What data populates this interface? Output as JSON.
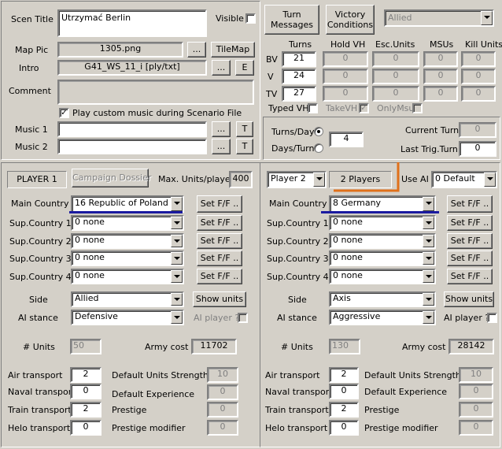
{
  "scenario": {
    "title_label": "Scen Title",
    "title_value": "Utrzymać Berlin",
    "visible_label": "Visible",
    "map_pic_label": "Map Pic",
    "map_pic_value": "1305.png",
    "browse_label": "...",
    "tilemap_label": "TileMap",
    "intro_label": "Intro",
    "intro_value": "G41_WS_11_i  [ply/txt]",
    "e_label": "E",
    "comment_label": "Comment",
    "play_music_label": "Play custom music during Scenario File",
    "music1_label": "Music 1",
    "music2_label": "Music 2",
    "t_label": "T"
  },
  "top_right": {
    "turn_messages_label": "Turn\nMessages",
    "victory_conditions_label": "Victory\nConditions",
    "allied_value": "Allied",
    "col_turns": "Turns",
    "col_hold_vh": "Hold VH",
    "col_esc_units": "Esc.Units",
    "col_msus": "MSUs",
    "col_kill_units": "Kill Units",
    "rows": [
      {
        "label": "BV",
        "turns": "21",
        "hold": "0",
        "esc": "0",
        "msu": "0",
        "kill": "0"
      },
      {
        "label": "V",
        "turns": "24",
        "hold": "0",
        "esc": "0",
        "msu": "0",
        "kill": "0"
      },
      {
        "label": "TV",
        "turns": "27",
        "hold": "0",
        "esc": "0",
        "msu": "0",
        "kill": "0"
      }
    ],
    "typed_vh": "Typed VH",
    "take_vh": "TakeVH",
    "only_msu": "OnlyMsu",
    "turns_per_day": "Turns/Day",
    "days_per_turn": "Days/Turn",
    "turns_value": "4",
    "current_turn_label": "Current Turn",
    "current_turn_value": "0",
    "last_trig_label": "Last Trig.Turn",
    "last_trig_value": "0"
  },
  "player1": {
    "player_label": "PLAYER 1",
    "campaign_dossier": "Campaign Dossier",
    "max_units_label": "Max. Units/player",
    "max_units_value": "400",
    "main_country_label": "Main Country",
    "main_country_value": "16 Republic of Poland",
    "set_ff": "Set F/F ..",
    "sup_labels": [
      "Sup.Country 1",
      "Sup.Country 2",
      "Sup.Country 3",
      "Sup.Country 4"
    ],
    "sup_values": [
      "0 none",
      "0 none",
      "0 none",
      "0 none"
    ],
    "side_label": "Side",
    "side_value": "Allied",
    "show_units": "Show units",
    "ai_stance_label": "AI stance",
    "ai_stance_value": "Defensive",
    "ai_player_label": "AI player ?",
    "units_label": "# Units",
    "units_value": "50",
    "army_cost_label": "Army cost",
    "army_cost_value": "11702",
    "air_label": "Air transport",
    "air_value": "2",
    "naval_label": "Naval transport",
    "naval_value": "0",
    "train_label": "Train  transport",
    "train_value": "2",
    "helo_label": "Helo  transport",
    "helo_value": "0",
    "dus_label": "Default Units Strength",
    "dus_value": "10",
    "de_label": "Default Experience",
    "de_value": "0",
    "prestige_label": "Prestige",
    "prestige_value": "0",
    "pm_label": "Prestige modifier",
    "pm_value": "0"
  },
  "player2": {
    "player_select": "Player 2",
    "players_label": "2 Players",
    "use_ai_label": "Use AI",
    "use_ai_value": "0  Default",
    "main_country_label": "Main Country",
    "main_country_value": "8  Germany",
    "set_ff": "Set F/F ..",
    "sup_labels": [
      "Sup.Country 1",
      "Sup.Country 2",
      "Sup.Country 3",
      "Sup.Country 4"
    ],
    "sup_values": [
      "0 none",
      "0 none",
      "0 none",
      "0 none"
    ],
    "side_label": "Side",
    "side_value": "Axis",
    "show_units": "Show units",
    "ai_stance_label": "AI stance",
    "ai_stance_value": "Aggressive",
    "ai_player_label": "AI player ?",
    "units_label": "# Units",
    "units_value": "130",
    "army_cost_label": "Army cost",
    "army_cost_value": "28142",
    "air_label": "Air transport",
    "air_value": "2",
    "naval_label": "Naval transport",
    "naval_value": "0",
    "train_label": "Train  transport",
    "train_value": "2",
    "helo_label": "Helo  transport",
    "helo_value": "0",
    "dus_label": "Default Units Strength",
    "dus_value": "10",
    "de_label": "Default Experience",
    "de_value": "0",
    "prestige_label": "Prestige",
    "prestige_value": "0",
    "pm_label": "Prestige modifier",
    "pm_value": "0"
  },
  "annotation_colors": {
    "underline": "#1a1aa0",
    "bracket": "#e0701a"
  }
}
